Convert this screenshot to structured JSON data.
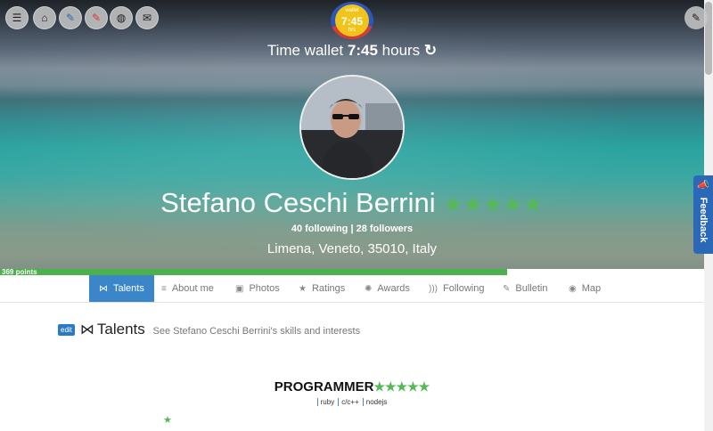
{
  "toolbar": {
    "buttons": [
      {
        "icon": "menu-icon",
        "glyph": "☰"
      },
      {
        "icon": "home-icon",
        "glyph": "⌂"
      },
      {
        "icon": "pin-icon",
        "glyph": "✎"
      },
      {
        "icon": "pin-red-icon",
        "glyph": "✎"
      },
      {
        "icon": "globe-icon",
        "glyph": "◍"
      },
      {
        "icon": "mail-icon",
        "glyph": "✉"
      }
    ],
    "edit_glyph": "✎"
  },
  "wallet": {
    "badge_top": "wallet",
    "badge_time": "7:45",
    "badge_bottom": "hrs",
    "label": "Time wallet",
    "time": "7:45",
    "unit": "hours",
    "refresh_glyph": "↻"
  },
  "profile": {
    "name": "Stefano Ceschi Berrini",
    "stars": "★★★★★",
    "following": "40 following | 28 followers",
    "location": "Limena, Veneto, 35010, Italy"
  },
  "points": {
    "label": "369 points",
    "progress": 0.72
  },
  "feedback": {
    "label": "Feedback",
    "icon_glyph": "📣"
  },
  "tabs": [
    {
      "label": "Talents",
      "glyph": "⋈",
      "active": true
    },
    {
      "label": "About me",
      "glyph": "≡"
    },
    {
      "label": "Photos",
      "glyph": "▣"
    },
    {
      "label": "Ratings",
      "glyph": "★"
    },
    {
      "label": "Awards",
      "glyph": "✺"
    },
    {
      "label": "Following",
      "glyph": ")))"
    },
    {
      "label": "Bulletin",
      "glyph": "✎"
    },
    {
      "label": "Map",
      "glyph": "◉"
    }
  ],
  "section": {
    "edit_label": "edit",
    "title": "Talents",
    "subtitle": "See Stefano Ceschi Berrini's skills and interests"
  },
  "skill": {
    "title": "PROGRAMMER",
    "stars": "★★★★★",
    "tags": [
      "ruby",
      "c/c++",
      "nodejs"
    ]
  },
  "lone_star": "★"
}
